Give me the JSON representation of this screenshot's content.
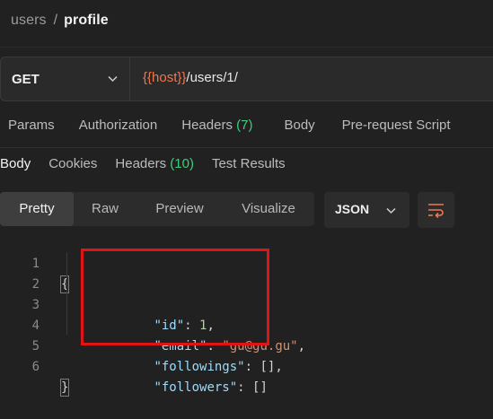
{
  "breadcrumb": {
    "parent": "users",
    "separator": "/",
    "current": "profile"
  },
  "request": {
    "method": "GET",
    "url_variable": "{{host}}",
    "url_path": "/users/1/"
  },
  "request_tabs": [
    {
      "label": "Params"
    },
    {
      "label": "Authorization"
    },
    {
      "label": "Headers",
      "count": "(7)"
    },
    {
      "label": "Body"
    },
    {
      "label": "Pre-request Script"
    }
  ],
  "response_tabs": [
    {
      "label": "Body",
      "active": true
    },
    {
      "label": "Cookies"
    },
    {
      "label": "Headers",
      "count": "(10)"
    },
    {
      "label": "Test Results"
    }
  ],
  "view_modes": [
    {
      "label": "Pretty",
      "active": true
    },
    {
      "label": "Raw"
    },
    {
      "label": "Preview"
    },
    {
      "label": "Visualize"
    }
  ],
  "format": {
    "selected": "JSON"
  },
  "icons": {
    "method_dropdown": "chevron-down-icon",
    "format_dropdown": "chevron-down-icon",
    "wrap": "wrap-lines-icon"
  },
  "colors": {
    "accent_orange": "#f0764f",
    "count_green": "#3ccf7c",
    "annotation_red": "#e01414",
    "json_key": "#9cdcfe",
    "json_string": "#ce9178",
    "json_number": "#b5cea8"
  },
  "response_body": {
    "line_numbers": [
      "1",
      "2",
      "3",
      "4",
      "5",
      "6"
    ],
    "open_brace": "{",
    "close_brace": "}",
    "fields": [
      {
        "key": "\"id\"",
        "value": "1",
        "type": "number",
        "trailing": ","
      },
      {
        "key": "\"email\"",
        "value": "\"gu@gu.gu\"",
        "type": "string",
        "trailing": ","
      },
      {
        "key": "\"followings\"",
        "value": "[]",
        "type": "array",
        "trailing": ","
      },
      {
        "key": "\"followers\"",
        "value": "[]",
        "type": "array",
        "trailing": ""
      }
    ],
    "key_value_separator": ": "
  }
}
